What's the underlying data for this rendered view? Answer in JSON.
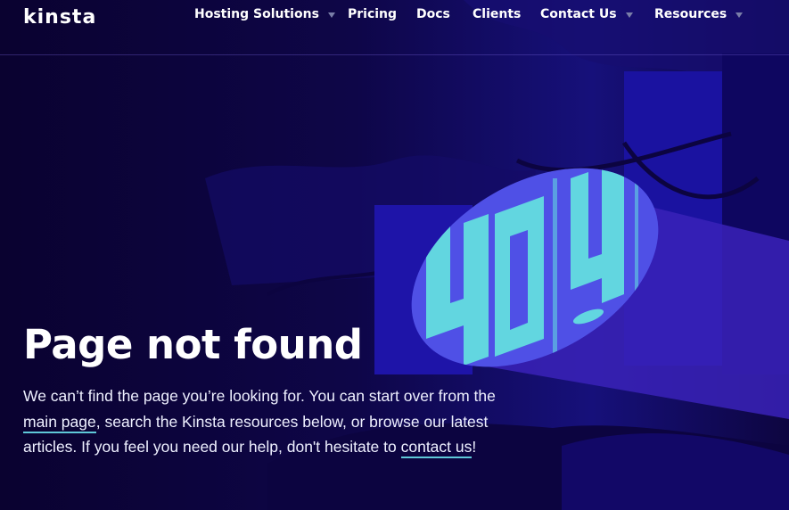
{
  "header": {
    "logo_text": "kinsta",
    "nav": [
      {
        "label": "Hosting Solutions",
        "has_dropdown": true
      },
      {
        "label": "Pricing",
        "has_dropdown": false
      },
      {
        "label": "Docs",
        "has_dropdown": false
      },
      {
        "label": "Clients",
        "has_dropdown": false
      },
      {
        "label": "Contact Us",
        "has_dropdown": true
      },
      {
        "label": "Resources",
        "has_dropdown": true
      }
    ]
  },
  "illustration": {
    "label": "404",
    "icon": "404-spotlight-illustration"
  },
  "main": {
    "title": "Page not found",
    "desc_part1": "We can’t find the page you’re looking for. You can start over from the ",
    "link_main_page": "main page",
    "desc_part2": ", search the Kinsta resources below, or browse our latest articles. If you feel you need our help, don't hesitate to ",
    "link_contact": "contact us",
    "desc_part3": "!"
  },
  "colors": {
    "background": "#0b0230",
    "accent_cyan": "#5fd3de",
    "spotlight_purple": "#4a2fd0",
    "link_underline": "#5fc8d8"
  }
}
